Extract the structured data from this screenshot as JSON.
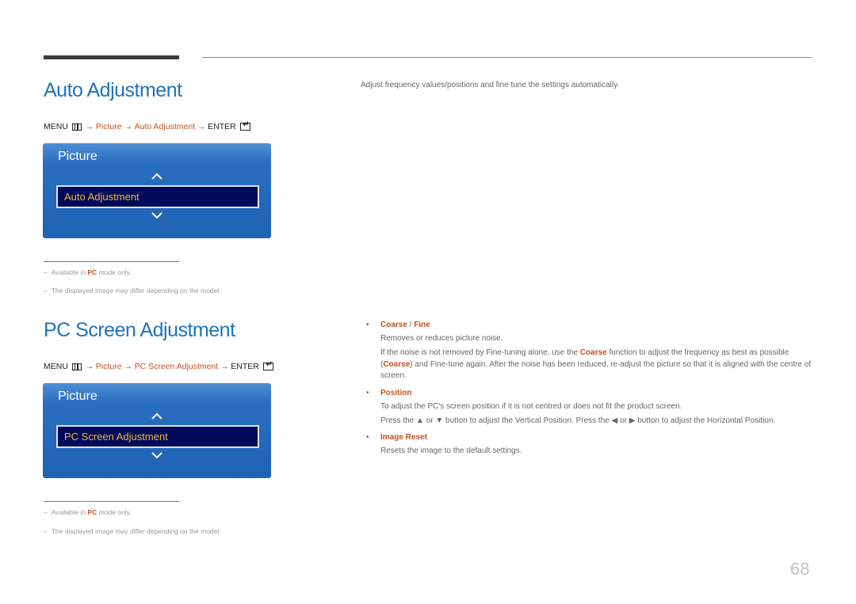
{
  "sections": [
    {
      "title": "Auto Adjustment",
      "menu_path": {
        "menu": "MENU",
        "menu_icon": "menu-icon",
        "arrow": "→",
        "picture": "Picture",
        "item": "Auto Adjustment",
        "enter": "ENTER",
        "enter_icon": "enter-icon"
      },
      "osd": {
        "title": "Picture",
        "up_icon": "chevron-up-icon",
        "selected_item": "Auto Adjustment",
        "down_icon": "chevron-down-icon"
      },
      "notes": [
        {
          "dash": "–",
          "prefix": "Available in ",
          "highlight": "PC",
          "suffix": " mode only."
        },
        {
          "dash": "–",
          "text": "The displayed image may differ depending on the model."
        }
      ],
      "description": "Adjust frequency values/positions and fine tune the settings automatically."
    },
    {
      "title": "PC Screen Adjustment",
      "menu_path": {
        "menu": "MENU",
        "menu_icon": "menu-icon",
        "arrow": "→",
        "picture": "Picture",
        "item": "PC Screen Adjustment",
        "enter": "ENTER",
        "enter_icon": "enter-icon"
      },
      "osd": {
        "title": "Picture",
        "up_icon": "chevron-up-icon",
        "selected_item": "PC Screen Adjustment",
        "down_icon": "chevron-down-icon"
      },
      "notes": [
        {
          "dash": "–",
          "prefix": "Available in ",
          "highlight": "PC",
          "suffix": " mode only."
        },
        {
          "dash": "–",
          "text": "The displayed image may differ depending on the model."
        }
      ],
      "options": [
        {
          "bullet": "•",
          "title_a": "Coarse",
          "title_sep": " / ",
          "title_b": "Fine",
          "line1": "Removes or reduces picture noise.",
          "line2_a": "If the noise is not removed by Fine-tuning alone, use the ",
          "line2_b": "Coarse",
          "line2_c": " function to adjust the frequency as best as possible (",
          "line2_d": "Coarse",
          "line2_e": ") and Fine-tune again. After the noise has been reduced, re-adjust the picture so that it is aligned with the centre of screen."
        },
        {
          "bullet": "•",
          "title": "Position",
          "line1": "To adjust the PC's screen position if it is not centred or does not fit the product screen.",
          "line2": "Press the ▲ or ▼ button to adjust the Vertical Position. Press the ◀ or ▶ button to adjust the Horizontal Position."
        },
        {
          "bullet": "•",
          "title": "Image Reset",
          "line1": "Resets the image to the default settings."
        }
      ]
    }
  ],
  "page_number": "68",
  "colors": {
    "title_blue": "#1f73b7",
    "accent_orange": "#c5501f",
    "osd_blue": "#1d62b3",
    "osd_selected_bg": "#020a5c",
    "osd_selected_text": "#f5b72a"
  }
}
